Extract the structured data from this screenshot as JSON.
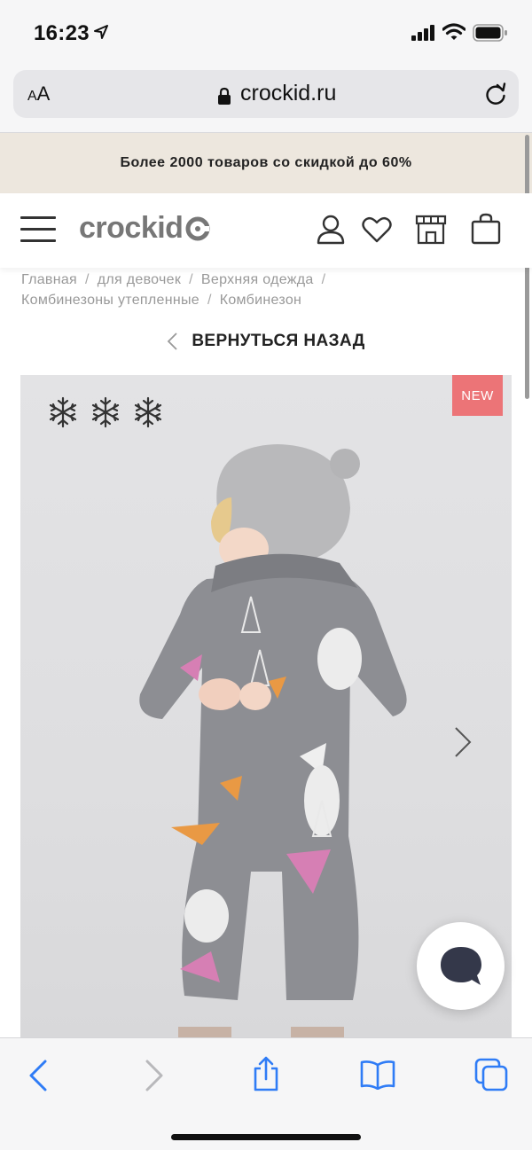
{
  "status_bar": {
    "time": "16:23"
  },
  "browser": {
    "font_size_label": "AA",
    "url": "crockid.ru"
  },
  "promo": {
    "text": "Более 2000 товаров со скидкой до 60%"
  },
  "header": {
    "logo_text": "crockid"
  },
  "breadcrumb": {
    "items": [
      "Главная",
      "для девочек",
      "Верхняя одежда",
      "Комбинезоны утепленные",
      "Комбинезон"
    ],
    "separator": "/"
  },
  "back": {
    "label": "ВЕРНУТЬСЯ НАЗАД"
  },
  "product": {
    "badge": "NEW",
    "badge_color": "#ec7477",
    "warmth_icons": [
      "snowflake-icon",
      "snowflake-icon",
      "snowflake-icon"
    ]
  },
  "colors": {
    "promo_bg": "#ede7de",
    "accent_blue": "#2f7cf6",
    "logo_gray": "#777777"
  }
}
